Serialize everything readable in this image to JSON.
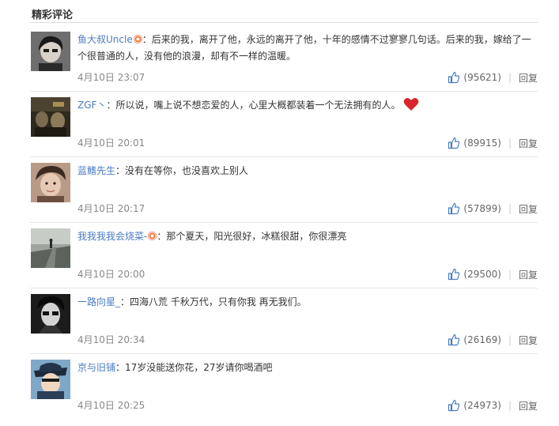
{
  "section_title": "精彩评论",
  "comments": [
    {
      "username": "鱼大叔Uncle",
      "text": "：后来的我，离开了他，永远的离开了他，十年的感情不过寥寥几句话。后来的我，嫁给了一个很普通的人，没有他的浪漫，却有不一样的温暖。",
      "timestamp": "4月10日 23:07",
      "likes": "(95621)",
      "reply": "回复"
    },
    {
      "username": "ZGF丶",
      "text": "：所以说，嘴上说不想恋爱的人，心里大概都装着一个无法拥有的人。",
      "timestamp": "4月10日 20:01",
      "likes": "(89915)",
      "reply": "回复"
    },
    {
      "username": "蓝鳍先生",
      "text": "：没有在等你，也没喜欢上别人",
      "timestamp": "4月10日 20:17",
      "likes": "(57899)",
      "reply": "回复"
    },
    {
      "username": "我我我我会烧菜-",
      "text": "：那个夏天，阳光很好，冰糕很甜，你很漂亮",
      "timestamp": "4月10日 20:00",
      "likes": "(29500)",
      "reply": "回复"
    },
    {
      "username": "一路向星_",
      "text": "：四海八荒 千秋万代，只有你我 再无我们。",
      "timestamp": "4月10日 20:34",
      "likes": "(26169)",
      "reply": "回复"
    },
    {
      "username": "京与旧铺",
      "text": "：17岁没能送你花，27岁请你喝酒吧",
      "timestamp": "4月10日 20:25",
      "likes": "(24973)",
      "reply": "回复"
    }
  ],
  "icons": {
    "vip_badge": "vip-badge-icon",
    "heart": "heart-emoji-icon",
    "like": "thumbs-up-icon"
  },
  "colors": {
    "username": "#4a7cc1",
    "meta": "#888888",
    "heart": "#d9262c",
    "like_icon": "#4a7cc1"
  }
}
